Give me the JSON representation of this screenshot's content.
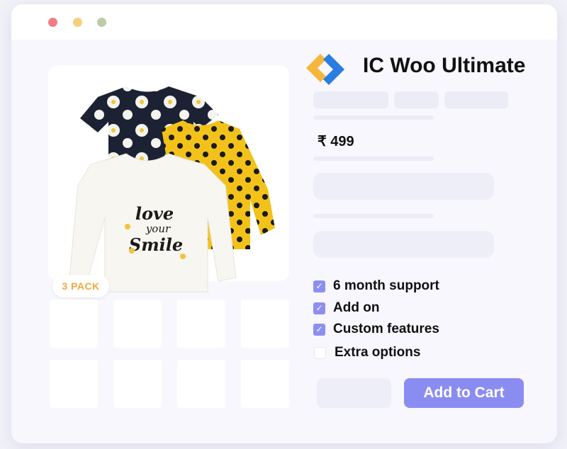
{
  "window": {
    "controls": {
      "close_color": "#f07d85",
      "minimize_color": "#f6cf7a",
      "maximize_color": "#bccba8"
    }
  },
  "product": {
    "badge": "3 PACK",
    "badge_color": "#f2a93b",
    "print_lines": [
      "love",
      "your",
      "Smile"
    ]
  },
  "brand": {
    "title": "IC Woo Ultimate",
    "logo_colors": {
      "orange": "#f4b73b",
      "blue": "#2a7de1"
    }
  },
  "price": "₹ 499",
  "options": [
    {
      "label": "6 month support",
      "checked": true
    },
    {
      "label": "Add on",
      "checked": true
    },
    {
      "label": "Custom features",
      "checked": true
    },
    {
      "label": "Extra options",
      "checked": false
    }
  ],
  "checkmark": "✓",
  "cart": {
    "label": "Add to Cart",
    "color": "#8b8cf2"
  }
}
